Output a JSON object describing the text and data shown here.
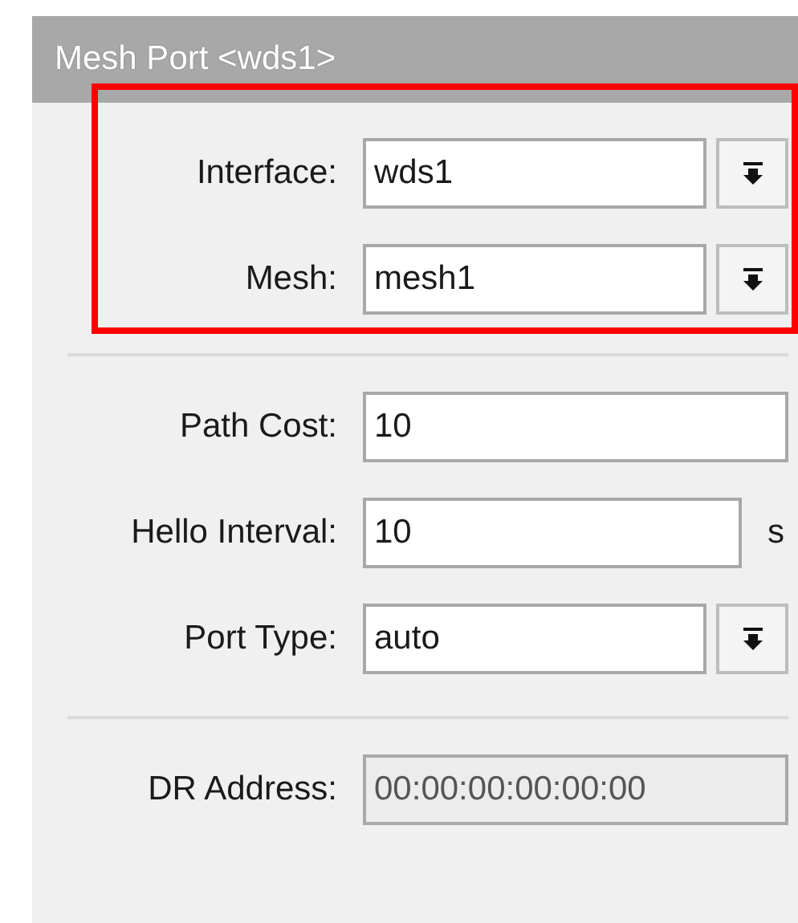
{
  "window": {
    "title": "Mesh Port <wds1>"
  },
  "sections": [
    {
      "highlighted": true,
      "fields": [
        {
          "kind": "dropdown",
          "label": "Interface:",
          "value": "wds1"
        },
        {
          "kind": "dropdown",
          "label": "Mesh:",
          "value": "mesh1"
        }
      ]
    },
    {
      "highlighted": false,
      "fields": [
        {
          "kind": "text",
          "label": "Path Cost:",
          "value": "10"
        },
        {
          "kind": "text",
          "label": "Hello Interval:",
          "value": "10",
          "unit": "s"
        },
        {
          "kind": "dropdown",
          "label": "Port Type:",
          "value": "auto"
        }
      ]
    },
    {
      "highlighted": false,
      "fields": [
        {
          "kind": "readonly",
          "label": "DR Address:",
          "value": "00:00:00:00:00:00"
        }
      ]
    }
  ]
}
